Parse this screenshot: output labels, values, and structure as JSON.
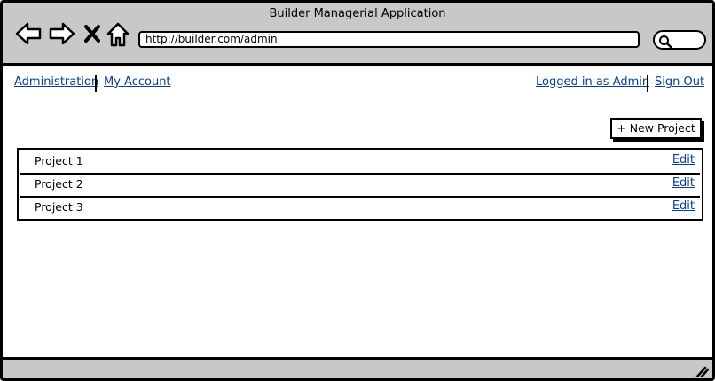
{
  "window": {
    "title": "Builder Managerial Application"
  },
  "browser": {
    "url": "http://builder.com/admin",
    "icons": [
      "back-arrow-icon",
      "forward-arrow-icon",
      "close-x-icon",
      "home-icon",
      "search-icon",
      "resize-grip-icon"
    ]
  },
  "nav": {
    "left": [
      "Administration",
      "My Account"
    ],
    "right": [
      "Logged in as Admin",
      "Sign Out"
    ]
  },
  "actions": {
    "new_project_label": "+ New Project"
  },
  "projects": [
    {
      "name": "Project 1",
      "action": "Edit"
    },
    {
      "name": "Project 2",
      "action": "Edit"
    },
    {
      "name": "Project 3",
      "action": "Edit"
    }
  ],
  "colors": {
    "chrome": "#c8c8c8",
    "link": "#0b3f87",
    "border": "#000000"
  }
}
